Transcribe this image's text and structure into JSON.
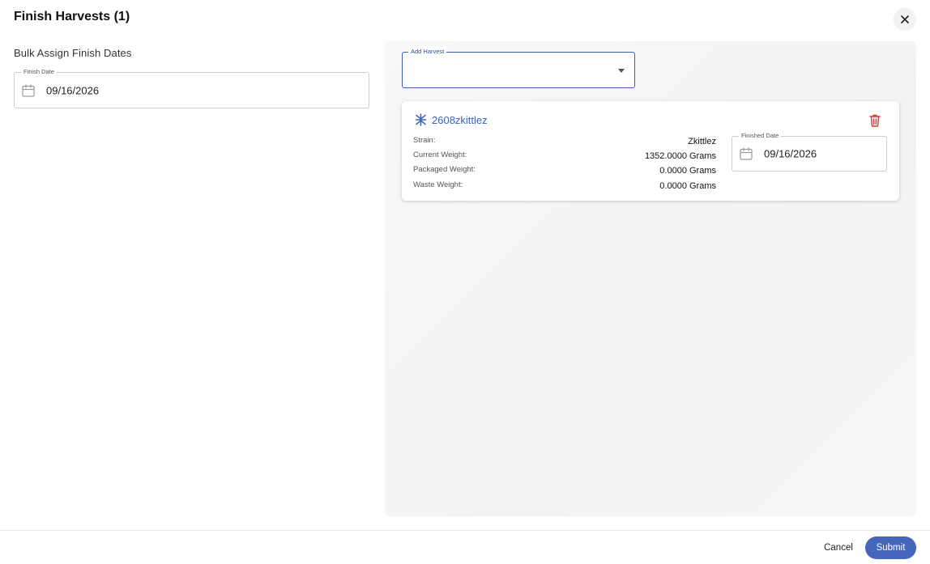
{
  "dialog": {
    "title": "Finish Harvests (1)",
    "close_icon": "close-icon"
  },
  "bulk": {
    "heading": "Bulk Assign Finish Dates",
    "finish_date_label": "Finish Date",
    "finish_date_value": "09/16/2026",
    "icon": "calendar-icon"
  },
  "add_harvest": {
    "label": "Add Harvest",
    "value": "",
    "icon": "chevron-down-icon"
  },
  "harvests": [
    {
      "icon": "harvest-icon",
      "name": "2608zkittlez",
      "strain_label": "Strain:",
      "strain_value": "Zkittlez",
      "current_weight_label": "Current Weight:",
      "current_weight_value": "1352.0000 Grams",
      "packaged_weight_label": "Packaged Weight:",
      "packaged_weight_value": "0.0000 Grams",
      "waste_weight_label": "Waste Weight:",
      "waste_weight_value": "0.0000 Grams",
      "finished_date_label": "Finished Date",
      "finished_date_value": "09/16/2026",
      "delete_icon": "trash-icon"
    }
  ],
  "footer": {
    "cancel_label": "Cancel",
    "submit_label": "Submit"
  },
  "colors": {
    "accent": "#4466bb",
    "link": "#3a63b8",
    "danger": "#d23b3b"
  }
}
